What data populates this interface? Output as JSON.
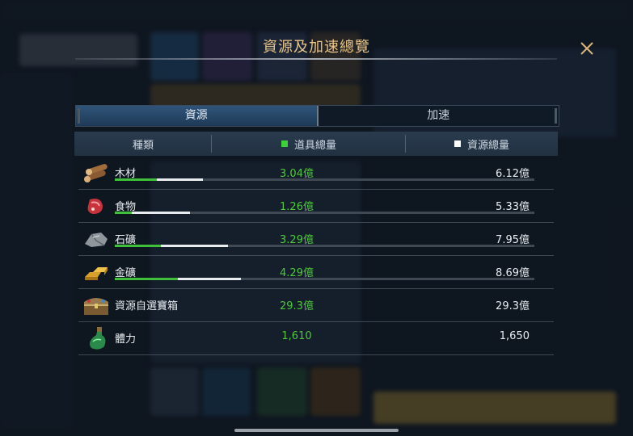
{
  "dialog": {
    "title": "資源及加速總覽",
    "tabs": [
      {
        "label": "資源",
        "active": true
      },
      {
        "label": "加速",
        "active": false
      }
    ],
    "columns": {
      "type": "種類",
      "item_total": "道具總量",
      "resource_total": "資源總量"
    },
    "colors": {
      "item_green": "#4ec83a",
      "bar_green": "#3fbf3a",
      "bar_white": "#e8ecef",
      "title_gold": "#e8c58a"
    },
    "rows": [
      {
        "icon": "wood-logs-icon",
        "name": "木材",
        "item_total": "3.04億",
        "resource_total": "6.12億",
        "has_bar": true,
        "item_fraction": 0.1,
        "resource_fraction": 0.21
      },
      {
        "icon": "meat-icon",
        "name": "食物",
        "item_total": "1.26億",
        "resource_total": "5.33億",
        "has_bar": true,
        "item_fraction": 0.04,
        "resource_fraction": 0.18
      },
      {
        "icon": "stone-icon",
        "name": "石礦",
        "item_total": "3.29億",
        "resource_total": "7.95億",
        "has_bar": true,
        "item_fraction": 0.11,
        "resource_fraction": 0.27
      },
      {
        "icon": "gold-bars-icon",
        "name": "金礦",
        "item_total": "4.29億",
        "resource_total": "8.69億",
        "has_bar": true,
        "item_fraction": 0.15,
        "resource_fraction": 0.3
      },
      {
        "icon": "treasure-chest-icon",
        "name": "資源自選寶箱",
        "item_total": "29.3億",
        "resource_total": "29.3億",
        "has_bar": false
      },
      {
        "icon": "potion-bottle-icon",
        "name": "體力",
        "item_total": "1,610",
        "resource_total": "1,650",
        "has_bar": false
      }
    ]
  }
}
